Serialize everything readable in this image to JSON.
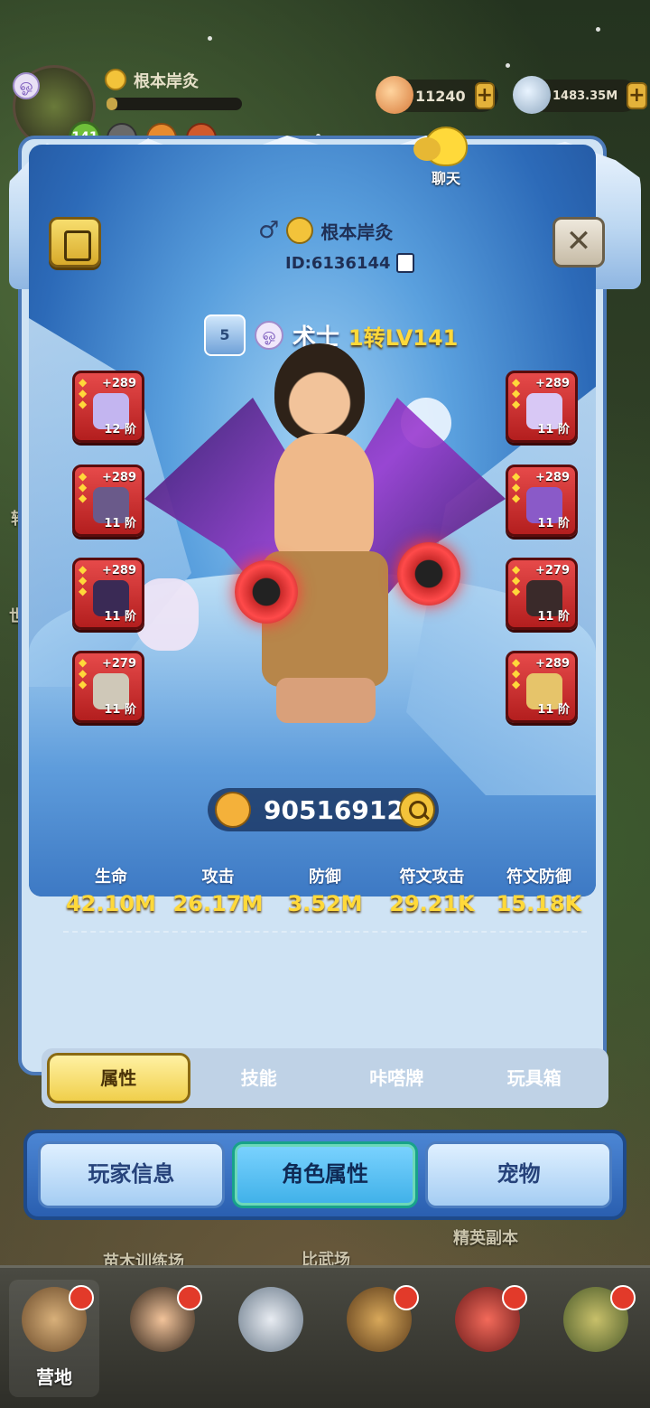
{
  "hud": {
    "player_name": "根本岸灸",
    "level": "141",
    "gold": "11240",
    "gems": "1483.35M",
    "gold_plus": "+",
    "gems_plus": "+"
  },
  "chat": {
    "label": "聊天"
  },
  "profile": {
    "gender_symbol": "♂",
    "name": "根本岸灸",
    "id_text": "ID:6136144",
    "rank": "5",
    "class_icon": "ஓ",
    "class_name": "术士",
    "class_level": "1转LV141",
    "close_label": "✕"
  },
  "equipment_left": [
    {
      "plus": "+289",
      "tier": "12 阶",
      "icon": "staff-icon",
      "color": "#c3b5f0"
    },
    {
      "plus": "+289",
      "tier": "11 阶",
      "icon": "beast-armor-icon",
      "color": "#6a5a8a"
    },
    {
      "plus": "+289",
      "tier": "11 阶",
      "icon": "hat-icon",
      "color": "#3a2a55"
    },
    {
      "plus": "+279",
      "tier": "11 阶",
      "icon": "ring-icon",
      "color": "#cfc8b8"
    }
  ],
  "equipment_right": [
    {
      "plus": "+289",
      "tier": "11 阶",
      "icon": "staff-icon",
      "color": "#d8c8f5"
    },
    {
      "plus": "+289",
      "tier": "11 阶",
      "icon": "skull-cape-icon",
      "color": "#8a5ac8"
    },
    {
      "plus": "+279",
      "tier": "11 阶",
      "icon": "boots-icon",
      "color": "#3a2a2a"
    },
    {
      "plus": "+289",
      "tier": "11 阶",
      "icon": "necklace-icon",
      "color": "#e6c46a"
    }
  ],
  "power": {
    "value": "90516912"
  },
  "stats": [
    {
      "label": "生命",
      "value": "42.10M"
    },
    {
      "label": "攻击",
      "value": "26.17M"
    },
    {
      "label": "防御",
      "value": "3.52M"
    },
    {
      "label": "符文攻击",
      "value": "29.21K"
    },
    {
      "label": "符文防御",
      "value": "15.18K"
    }
  ],
  "sub_tabs": [
    "属性",
    "技能",
    "咔嗒牌",
    "玩具箱"
  ],
  "main_tabs": [
    "玩家信息",
    "角色属性",
    "宠物"
  ],
  "background_labels": {
    "elite": "精英副本",
    "training": "苗木训练场",
    "arena": "比武场",
    "side1": "转",
    "side2": "世"
  },
  "bottom_nav": {
    "camp": "营地"
  },
  "colors": {
    "accent": "#ffd93a",
    "slot_red": "#e64a4a",
    "panel_blue": "#2c6ab8"
  }
}
